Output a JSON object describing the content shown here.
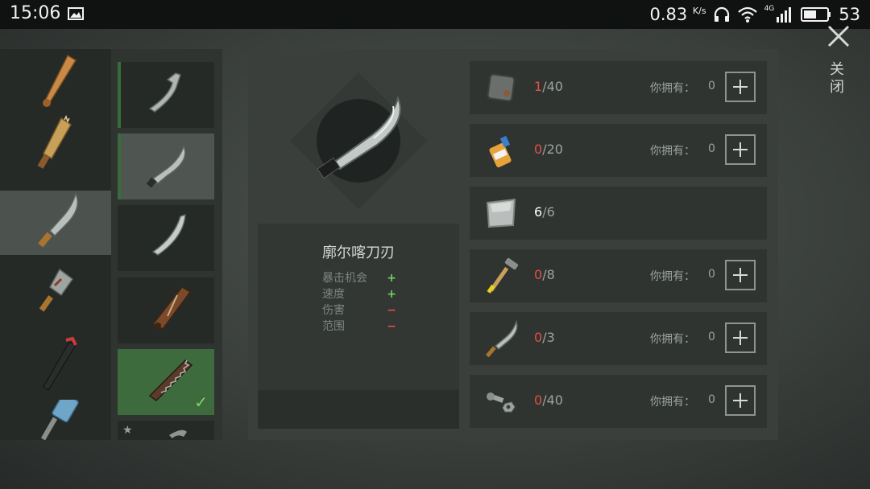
{
  "status_bar": {
    "time": "15:06",
    "net_speed": "0.83",
    "net_unit": "K/s",
    "network_type": "4G",
    "battery": "53",
    "icons": [
      "gallery-icon",
      "headphones-icon",
      "wifi-icon",
      "signal-icon",
      "battery-icon"
    ]
  },
  "weapons_column": {
    "items": [
      {
        "name": "baseball-bat-icon"
      },
      {
        "name": "wooden-board-icon"
      },
      {
        "name": "machete-icon",
        "active": true
      },
      {
        "name": "cleaver-icon"
      },
      {
        "name": "crowbar-icon"
      },
      {
        "name": "hammer-icon"
      }
    ]
  },
  "variants_column": {
    "items": [
      {
        "name": "hook-blade-icon"
      },
      {
        "name": "kukri-blade-icon",
        "selected": true
      },
      {
        "name": "curved-blade-icon"
      },
      {
        "name": "sheathed-blade-icon"
      },
      {
        "name": "chainsaw-blade-icon",
        "unlocked": true
      },
      {
        "name": "locked-blade-icon",
        "starred": true
      }
    ]
  },
  "item": {
    "name": "廓尔喀刀刃",
    "stats": [
      {
        "label": "暴击机会",
        "sign": "+"
      },
      {
        "label": "速度",
        "sign": "+"
      },
      {
        "label": "伤害",
        "sign": "−"
      },
      {
        "label": "范围",
        "sign": "−"
      }
    ]
  },
  "requirements": [
    {
      "icon": "metal-plate-icon",
      "have": "1",
      "need": "/40",
      "own_label": "你拥有：",
      "own": "0",
      "addable": true
    },
    {
      "icon": "glue-icon",
      "have": "0",
      "need": "/20",
      "own_label": "你拥有：",
      "own": "0",
      "addable": true
    },
    {
      "icon": "steel-sheet-icon",
      "have": "6",
      "need": "/6",
      "ok": true,
      "addable": false
    },
    {
      "icon": "hammer-icon",
      "have": "0",
      "need": "/8",
      "own_label": "你拥有：",
      "own": "0",
      "addable": true
    },
    {
      "icon": "machete-icon",
      "have": "0",
      "need": "/3",
      "own_label": "你拥有：",
      "own": "0",
      "addable": true
    },
    {
      "icon": "bolts-nuts-icon",
      "have": "0",
      "need": "/40",
      "own_label": "你拥有：",
      "own": "0",
      "addable": true
    }
  ],
  "close": {
    "label": "关闭",
    "icon": "close-icon"
  }
}
